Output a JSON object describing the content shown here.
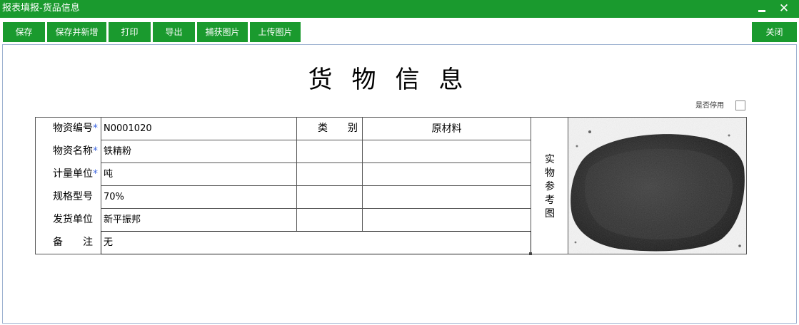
{
  "window": {
    "title": "报表填报-货品信息",
    "minimize_label": "",
    "close_label": "✕"
  },
  "toolbar": {
    "buttons": [
      {
        "label": "保存"
      },
      {
        "label": "保存并新增"
      },
      {
        "label": "打印"
      },
      {
        "label": "导出"
      },
      {
        "label": "捕获图片"
      },
      {
        "label": "上传图片"
      }
    ],
    "close_label": "关闭"
  },
  "form": {
    "title": "货物信息",
    "disabled_label": "是否停用",
    "disabled_checked": false,
    "rows": [
      {
        "label": "物资编号",
        "required": true,
        "value": "N0001020"
      },
      {
        "label": "物资名称",
        "required": true,
        "value": "铁精粉"
      },
      {
        "label": "计量单位",
        "required": true,
        "value": "吨"
      },
      {
        "label": "规格型号",
        "required": false,
        "value": "70%"
      },
      {
        "label": "发货单位",
        "required": false,
        "value": "新平振邦"
      },
      {
        "label": "备　　注",
        "required": false,
        "value": "无"
      }
    ],
    "category_label": "类　　别",
    "category_values": [
      "原材料",
      "",
      "",
      "",
      ""
    ],
    "photo_label": [
      "实",
      "物",
      "参",
      "考",
      "图"
    ],
    "required_mark": "*"
  },
  "colors": {
    "accent": "#1a9a2e",
    "required": "#4169e1"
  }
}
